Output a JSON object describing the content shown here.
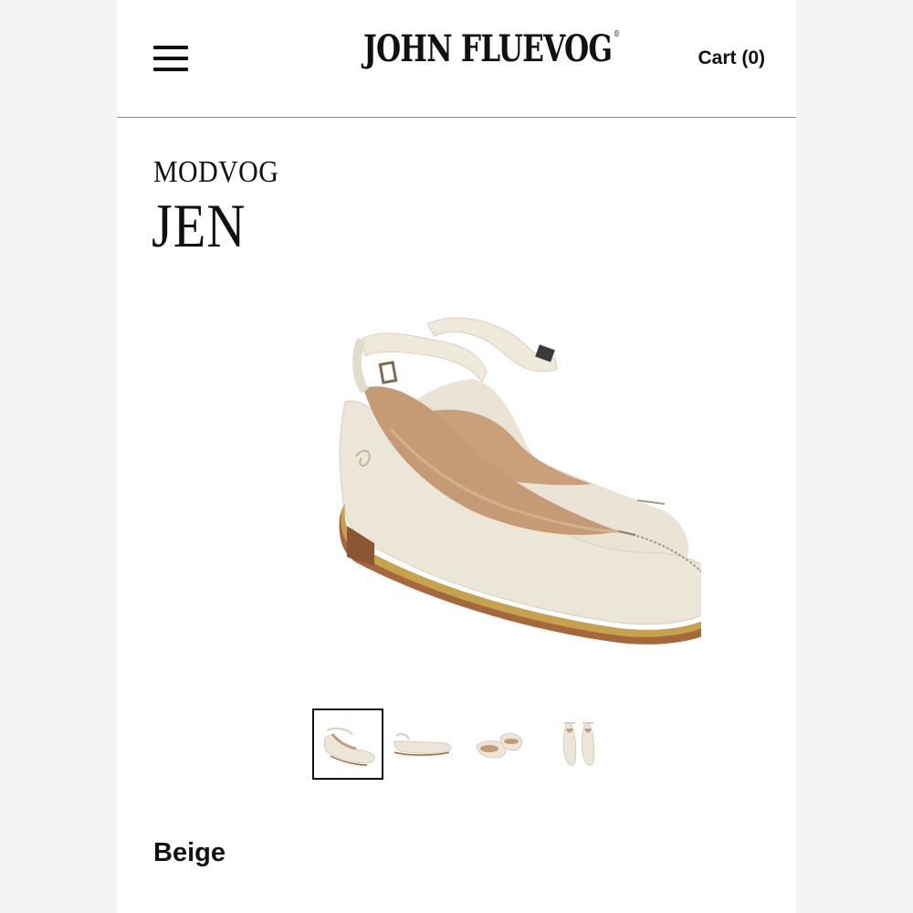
{
  "header": {
    "logo_text": "JOHN FLUEVOG",
    "logo_mark": "®",
    "cart_label": "Cart (0)",
    "menu_icon": "hamburger-menu-icon"
  },
  "product": {
    "collection": "MODVOG",
    "name": "JEN",
    "color": "Beige",
    "image_subject": "beige ankle-strap pointed-toe flats",
    "thumbnails": [
      {
        "view": "pair-angle",
        "selected": true
      },
      {
        "view": "side"
      },
      {
        "view": "pair-back"
      },
      {
        "view": "top"
      }
    ]
  },
  "colors": {
    "leather": "#ece6d9",
    "lining": "#c49b75",
    "sole": "#a5683e",
    "trim": "#c8a24a",
    "text": "#111111"
  }
}
